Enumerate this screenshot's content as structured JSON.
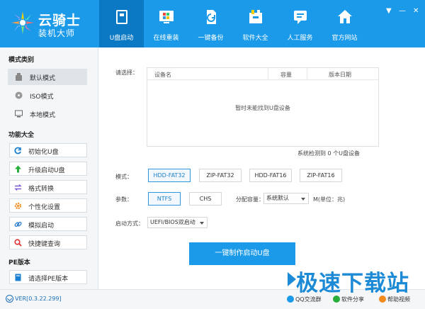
{
  "app": {
    "title": "云骑士",
    "subtitle": "装机大师"
  },
  "nav": {
    "tabs": [
      {
        "label": "U盘启动",
        "icon": "usb-drive-icon"
      },
      {
        "label": "在线重装",
        "icon": "windows-icon"
      },
      {
        "label": "一键备份",
        "icon": "backup-icon"
      },
      {
        "label": "软件大全",
        "icon": "software-box-icon"
      },
      {
        "label": "人工服务",
        "icon": "chat-service-icon"
      },
      {
        "label": "官方网站",
        "icon": "home-icon"
      }
    ]
  },
  "window": {
    "dropdown": "▼",
    "minimize": "—",
    "close": "✕"
  },
  "sidebar": {
    "mode_title": "模式类别",
    "modes": [
      {
        "label": "默认模式",
        "icon": "bottle-icon"
      },
      {
        "label": "ISO模式",
        "icon": "disc-icon"
      },
      {
        "label": "本地模式",
        "icon": "monitor-icon"
      }
    ],
    "func_title": "功能大全",
    "funcs": [
      {
        "label": "初始化U盘",
        "icon": "refresh-icon"
      },
      {
        "label": "升级启动U盘",
        "icon": "arrow-up-icon"
      },
      {
        "label": "格式转换",
        "icon": "convert-icon"
      },
      {
        "label": "个性化设置",
        "icon": "gear-icon"
      },
      {
        "label": "模拟启动",
        "icon": "link-icon"
      },
      {
        "label": "快捷键查询",
        "icon": "search-icon"
      }
    ],
    "pe_title": "PE版本",
    "pe_item": {
      "label": "请选择PE版本",
      "icon": "book-icon"
    }
  },
  "main": {
    "select_label": "请选择：",
    "columns": [
      "设备名",
      "容量",
      "版本日期"
    ],
    "empty_text": "暂时未能找到U盘设备",
    "count_text": "系统检测到 0 个U盘设备",
    "mode_label": "模式：",
    "modes": [
      "HDD-FAT32",
      "ZIP-FAT32",
      "HDD-FAT16",
      "ZIP-FAT16"
    ],
    "param_label": "参数：",
    "params": [
      "NTFS",
      "CHS"
    ],
    "alloc_label": "分配容量：",
    "alloc_value": "系统默认",
    "unit_label": "M(单位：兆)",
    "boot_label": "启动方式：",
    "boot_value": "UEFI/BIOS双启动",
    "make_button": "一键制作启动U盘"
  },
  "footer": {
    "version": "VER[0.3.22.299]",
    "links": [
      {
        "label": "QQ交流群",
        "icon": "qq-icon"
      },
      {
        "label": "软件分享",
        "icon": "share-icon"
      },
      {
        "label": "帮助视频",
        "icon": "help-icon"
      }
    ]
  },
  "watermark": "极速下载站",
  "colors": {
    "header": "#1a9ae8",
    "header_active": "#0a78c2",
    "accent": "#1a9ae8"
  }
}
